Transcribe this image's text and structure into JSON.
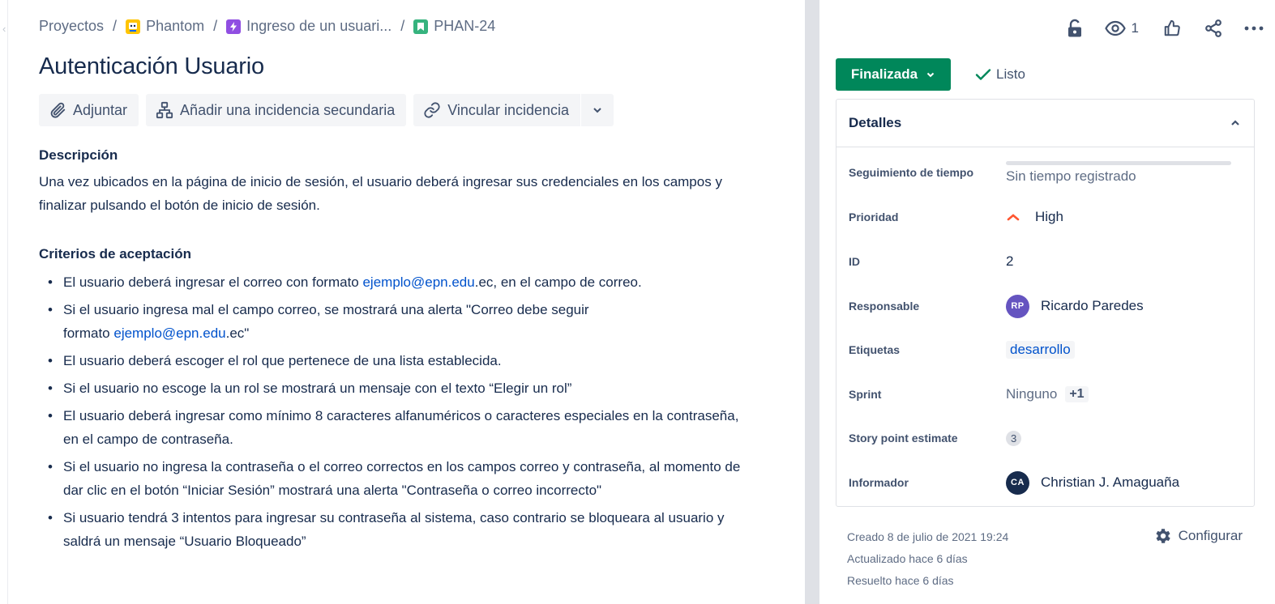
{
  "breadcrumb": {
    "items": [
      {
        "label": "Proyectos"
      },
      {
        "label": "Phantom"
      },
      {
        "label": "Ingreso de un usuari..."
      },
      {
        "label": "PHAN-24"
      }
    ],
    "separator": "/"
  },
  "issue": {
    "title": "Autenticación Usuario"
  },
  "toolbar": {
    "attach_label": "Adjuntar",
    "child_issue_label": "Añadir una incidencia secundaria",
    "link_issue_label": "Vincular incidencia"
  },
  "description": {
    "heading": "Descripción",
    "text": "Una vez ubicados en la página de inicio de sesión, el usuario deberá ingresar sus credenciales en los campos y finalizar pulsando el botón de inicio de sesión."
  },
  "criteria": {
    "heading": "Criterios de aceptación",
    "items": [
      {
        "before": "El usuario deberá ingresar el correo con formato ",
        "link": "ejemplo@epn.edu",
        "after": ".ec, en el campo de correo."
      },
      {
        "before": "Si el usuario ingresa mal el campo correo, se mostrará una alerta \"Correo debe seguir",
        "line2_before": "formato ",
        "link": "ejemplo@epn.edu",
        "after": ".ec\""
      },
      {
        "text": "El usuario deberá escoger el rol que pertenece de una lista establecida."
      },
      {
        "text": "Si el usuario no escoge la un rol se mostrará un mensaje con el texto “Elegir un rol”"
      },
      {
        "text": "El usuario deberá ingresar como mínimo 8 caracteres alfanuméricos o caracteres especiales en la contraseña, en el campo de contraseña."
      },
      {
        "text": " Si el usuario no ingresa la contraseña o el correo correctos en los campos correo y contraseña, al momento de dar clic en el botón “Iniciar Sesión” mostrará una alerta \"Contraseña o correo incorrecto\""
      },
      {
        "text": "Si usuario tendrá 3 intentos para ingresar su contraseña  al sistema, caso contrario se bloqueara al usuario y saldrá un mensaje “Usuario Bloqueado”"
      }
    ]
  },
  "top_actions": {
    "watchers_count": "1"
  },
  "status": {
    "label": "Finalizada",
    "color": "#00875A",
    "resolution": "Listo"
  },
  "details": {
    "heading": "Detalles",
    "fields": {
      "time_tracking": {
        "label": "Seguimiento de tiempo",
        "value": "Sin tiempo registrado"
      },
      "priority": {
        "label": "Prioridad",
        "value": "High",
        "color": "#FF5630"
      },
      "id": {
        "label": "ID",
        "value": "2"
      },
      "assignee": {
        "label": "Responsable",
        "initials": "RP",
        "name": "Ricardo Paredes",
        "avatar_color": "#6554C0"
      },
      "labels": {
        "label": "Etiquetas",
        "value": "desarrollo"
      },
      "sprint": {
        "label": "Sprint",
        "value": "Ninguno",
        "extra": "+1"
      },
      "story_points": {
        "label": "Story point estimate",
        "value": "3"
      },
      "reporter": {
        "label": "Informador",
        "initials": "CA",
        "name": "Christian J. Amaguaña",
        "avatar_color": "#172B4D"
      }
    }
  },
  "meta": {
    "created": "Creado 8 de julio de 2021 19:24",
    "updated": "Actualizado hace 6 días",
    "resolved": "Resuelto hace 6 días",
    "configure_label": "Configurar"
  }
}
